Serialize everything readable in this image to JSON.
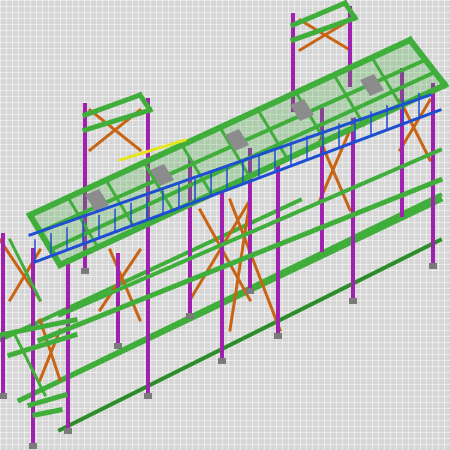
{
  "canvas": {
    "background": "#d6d6d6",
    "grid_color": "#ffffff"
  },
  "colors": {
    "beam": "#3fae3a",
    "beam_dark": "#2e8c2b",
    "column": "#a020b0",
    "brace": "#c86414",
    "walkway_rail": "#1e4fd0",
    "grating": "#8c8c8c",
    "base_plate": "#7a7a7a",
    "yellow_member": "#e6e61e"
  }
}
